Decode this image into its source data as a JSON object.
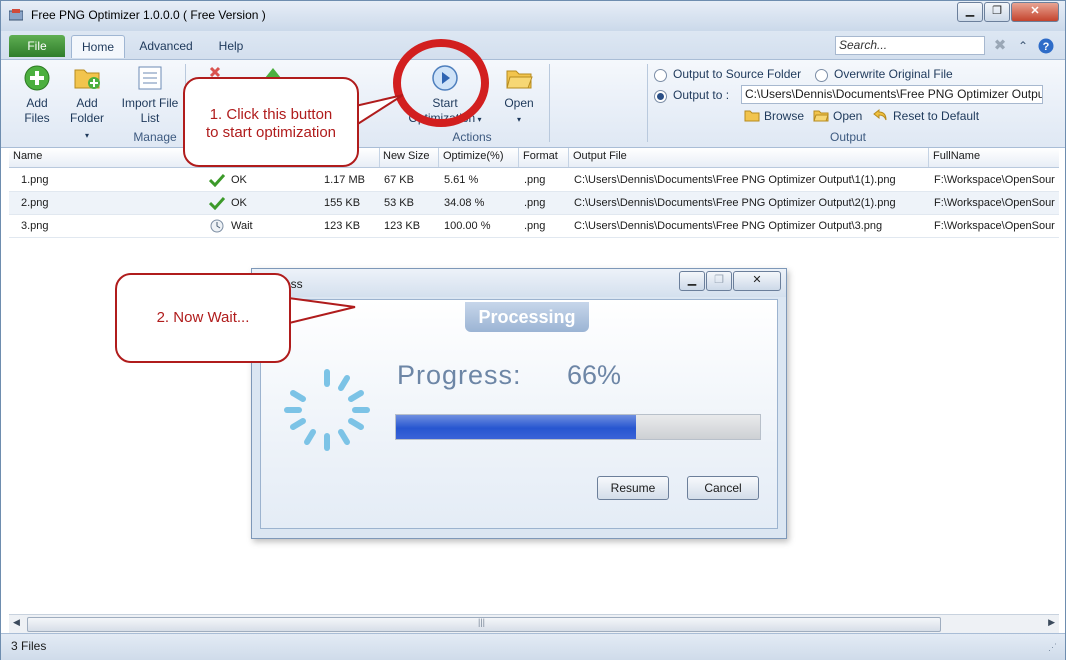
{
  "window": {
    "title": "Free PNG Optimizer 1.0.0.0 ( Free Version )",
    "controls": [
      "minimize",
      "maximize",
      "close"
    ]
  },
  "ribbon_tabs": {
    "file": "File",
    "home": "Home",
    "advanced": "Advanced",
    "help": "Help"
  },
  "search": {
    "placeholder": "Search..."
  },
  "ribbon": {
    "add_files_line1": "Add",
    "add_files_line2": "Files",
    "add_folder_line1": "Add",
    "add_folder_line2": "Folder",
    "import_line1": "Import File",
    "import_line2": "List",
    "manage_label": "Manage",
    "start_line1": "Start",
    "start_line2": "Optimization",
    "open_label": "Open",
    "actions_label": "Actions",
    "output_source": "Output to Source Folder",
    "overwrite": "Overwrite Original File",
    "output_to": "Output to :",
    "output_path": "C:\\Users\\Dennis\\Documents\\Free PNG Optimizer Output",
    "browse": "Browse",
    "open_small": "Open",
    "reset": "Reset to Default",
    "output_group": "Output",
    "selected_output": "Output to :"
  },
  "table": {
    "headers": {
      "name": "Name",
      "new_size": "New Size",
      "optimize": "Optimize(%)",
      "format": "Format",
      "output_file": "Output File",
      "fullname": "FullName"
    },
    "rows": [
      {
        "name": "1.png",
        "status": "OK",
        "size": "1.17 MB",
        "new_size": "67 KB",
        "optimize": "5.61 %",
        "format": ".png",
        "output": "C:\\Users\\Dennis\\Documents\\Free PNG Optimizer Output\\1(1).png",
        "full": "F:\\Workspace\\OpenSour"
      },
      {
        "name": "2.png",
        "status": "OK",
        "size": "155 KB",
        "new_size": "53 KB",
        "optimize": "34.08 %",
        "format": ".png",
        "output": "C:\\Users\\Dennis\\Documents\\Free PNG Optimizer Output\\2(1).png",
        "full": "F:\\Workspace\\OpenSour"
      },
      {
        "name": "3.png",
        "status": "Wait",
        "size": "123 KB",
        "new_size": "123 KB",
        "optimize": "100.00 %",
        "format": ".png",
        "output": "C:\\Users\\Dennis\\Documents\\Free PNG Optimizer Output\\3.png",
        "full": "F:\\Workspace\\OpenSour"
      }
    ]
  },
  "status_bar": {
    "text": "3 Files"
  },
  "progress_dialog": {
    "title": "ress",
    "badge": "Processing",
    "progress_label": "Progress:",
    "progress_value": "66%",
    "progress_fraction": 0.66,
    "resume": "Resume",
    "cancel": "Cancel"
  },
  "callouts": {
    "start_line1": "1. Click this button",
    "start_line2": "to start optimization",
    "wait": "2. Now Wait..."
  },
  "colors": {
    "callout": "#b01c1c",
    "progress_fill": "#2756d0",
    "file_tab": "#3b8a34"
  }
}
